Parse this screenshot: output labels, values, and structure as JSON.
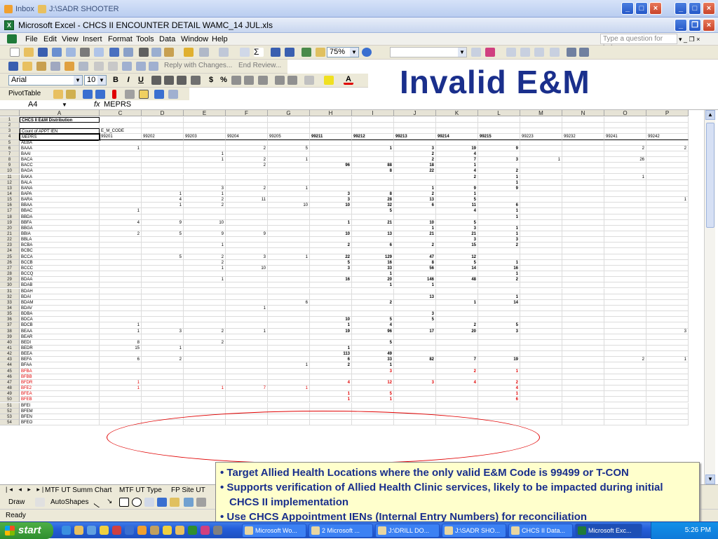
{
  "outer_window": {
    "tabs": [
      "Inbox",
      "J:\\SADR SHOOTER"
    ]
  },
  "excel": {
    "title": "Microsoft Excel - CHCS II ENCOUNTER DETAIL WAMC_14 JUL.xls",
    "menu": [
      "File",
      "Edit",
      "View",
      "Insert",
      "Format",
      "Tools",
      "Data",
      "Window",
      "Help"
    ],
    "ask_placeholder": "Type a question for help",
    "zoom": "75%",
    "font_name": "Arial",
    "font_size": "10",
    "reply_text": "Reply with Changes...",
    "end_review": "End Review...",
    "pivot_label": "PivotTable",
    "name_box": "A4",
    "fx": "fx",
    "formula_value": "MEPRS"
  },
  "slide": {
    "title": "Invalid E&M"
  },
  "grid": {
    "columns": [
      "A",
      "C",
      "D",
      "E",
      "F",
      "G",
      "H",
      "I",
      "J",
      "K",
      "L",
      "M",
      "N",
      "O",
      "P"
    ],
    "rows": [
      {
        "n": "1",
        "a": "CHCS II E&M Distribution",
        "v": [
          "",
          "",
          "",
          "",
          "",
          "",
          "",
          "",
          "",
          "",
          "",
          "",
          "",
          ""
        ]
      },
      {
        "n": "2",
        "a": "",
        "v": [
          "",
          "",
          "",
          "",
          "",
          "",
          "",
          "",
          "",
          "",
          "",
          "",
          "",
          ""
        ]
      },
      {
        "n": "3",
        "a": "Count of APPT IEN",
        "v": [
          "E_M_CODE",
          "",
          "",
          "",
          "",
          "",
          "",
          "",
          "",
          "",
          "",
          "",
          "",
          ""
        ]
      },
      {
        "n": "4",
        "a": "MEPRS",
        "v": [
          "99201",
          "99202",
          "99203",
          "99204",
          "99205",
          "99211",
          "99212",
          "99213",
          "99214",
          "99215",
          "99223",
          "99232",
          "99241",
          "99242"
        ]
      },
      {
        "n": "5",
        "a": "AEBA",
        "v": [
          "",
          "",
          "",
          "",
          "",
          "",
          "",
          "",
          "",
          "",
          "",
          "",
          "",
          ""
        ]
      },
      {
        "n": "6",
        "a": "BAAA",
        "v": [
          "1",
          "",
          "",
          "2",
          "5",
          "",
          "1",
          "3",
          "19",
          "9",
          "",
          "",
          "2",
          "2"
        ]
      },
      {
        "n": "7",
        "a": "BAAI",
        "v": [
          "",
          "",
          "1",
          "",
          "",
          "",
          "",
          "2",
          "4",
          "",
          "",
          "",
          "",
          ""
        ]
      },
      {
        "n": "8",
        "a": "BACA",
        "v": [
          "",
          "",
          "1",
          "2",
          "1",
          "",
          "",
          "2",
          "7",
          "3",
          "1",
          "",
          "26",
          ""
        ]
      },
      {
        "n": "9",
        "a": "BACC",
        "v": [
          "",
          "",
          "",
          "2",
          "",
          "96",
          "88",
          "18",
          "1",
          "",
          "",
          "",
          "",
          ""
        ]
      },
      {
        "n": "10",
        "a": "BAGA",
        "v": [
          "",
          "",
          "",
          "",
          "",
          "",
          "8",
          "22",
          "4",
          "2",
          "",
          "",
          "",
          ""
        ]
      },
      {
        "n": "11",
        "a": "BAKA",
        "v": [
          "",
          "",
          "",
          "",
          "",
          "",
          "",
          "",
          "2",
          "1",
          "",
          "",
          "1",
          ""
        ]
      },
      {
        "n": "12",
        "a": "BALA",
        "v": [
          "",
          "",
          "",
          "",
          "",
          "",
          "",
          "",
          "",
          "1",
          "",
          "",
          "",
          ""
        ]
      },
      {
        "n": "13",
        "a": "BANA",
        "v": [
          "",
          "",
          "3",
          "2",
          "1",
          "",
          "",
          "1",
          "9",
          "9",
          "",
          "",
          "",
          ""
        ]
      },
      {
        "n": "14",
        "a": "BAPA",
        "v": [
          "",
          "1",
          "1",
          "",
          "",
          "3",
          "8",
          "2",
          "1",
          "",
          "",
          "",
          "",
          ""
        ]
      },
      {
        "n": "15",
        "a": "BARA",
        "v": [
          "",
          "4",
          "2",
          "11",
          "",
          "3",
          "28",
          "13",
          "5",
          "",
          "",
          "",
          "",
          "1"
        ]
      },
      {
        "n": "16",
        "a": "BBAA",
        "v": [
          "",
          "1",
          "2",
          "",
          "10",
          "10",
          "32",
          "6",
          "11",
          "6",
          "",
          "",
          "",
          ""
        ]
      },
      {
        "n": "17",
        "a": "BBAC",
        "v": [
          "1",
          "",
          "",
          "",
          "",
          "",
          "5",
          "",
          "4",
          "1",
          "",
          "",
          "",
          ""
        ]
      },
      {
        "n": "18",
        "a": "BBDA",
        "v": [
          "",
          "",
          "",
          "",
          "",
          "",
          "",
          "",
          "",
          "1",
          "",
          "",
          "",
          ""
        ]
      },
      {
        "n": "19",
        "a": "BBFA",
        "v": [
          "4",
          "9",
          "10",
          "",
          "",
          "1",
          "21",
          "10",
          "5",
          "",
          "",
          "",
          "",
          ""
        ]
      },
      {
        "n": "20",
        "a": "BBGA",
        "v": [
          "",
          "",
          "",
          "",
          "",
          "",
          "",
          "1",
          "3",
          "1",
          "",
          "",
          "",
          ""
        ]
      },
      {
        "n": "21",
        "a": "BBIA",
        "v": [
          "2",
          "5",
          "9",
          "9",
          "",
          "10",
          "13",
          "21",
          "21",
          "1",
          "",
          "",
          "",
          ""
        ]
      },
      {
        "n": "22",
        "a": "BBLA",
        "v": [
          "",
          "",
          "",
          "",
          "",
          "",
          "",
          "",
          "3",
          "3",
          "",
          "",
          "",
          ""
        ]
      },
      {
        "n": "23",
        "a": "BCBA",
        "v": [
          "",
          "",
          "1",
          "",
          "",
          "2",
          "6",
          "2",
          "15",
          "2",
          "",
          "",
          "",
          ""
        ]
      },
      {
        "n": "24",
        "a": "BCBC",
        "v": [
          "",
          "",
          "",
          "",
          "",
          "",
          "",
          "",
          "",
          "",
          "",
          "",
          "",
          ""
        ]
      },
      {
        "n": "25",
        "a": "BCCA",
        "v": [
          "",
          "5",
          "2",
          "3",
          "1",
          "22",
          "129",
          "47",
          "12",
          "",
          "",
          "",
          "",
          ""
        ]
      },
      {
        "n": "26",
        "a": "BCCB",
        "v": [
          "",
          "",
          "2",
          "",
          "",
          "5",
          "16",
          "8",
          "5",
          "1",
          "",
          "",
          "",
          ""
        ]
      },
      {
        "n": "27",
        "a": "BCCC",
        "v": [
          "",
          "",
          "1",
          "10",
          "",
          "3",
          "33",
          "56",
          "14",
          "16",
          "",
          "",
          "",
          ""
        ]
      },
      {
        "n": "28",
        "a": "BCCQ",
        "v": [
          "",
          "",
          "",
          "",
          "",
          "",
          "1",
          "",
          "",
          "1",
          "",
          "",
          "",
          ""
        ]
      },
      {
        "n": "29",
        "a": "BDAA",
        "v": [
          "",
          "",
          "1",
          "",
          "",
          "16",
          "20",
          "146",
          "48",
          "2",
          "",
          "",
          "",
          ""
        ]
      },
      {
        "n": "30",
        "a": "BDAB",
        "v": [
          "",
          "",
          "",
          "",
          "",
          "",
          "1",
          "1",
          "",
          "",
          "",
          "",
          "",
          ""
        ]
      },
      {
        "n": "31",
        "a": "BDAH",
        "v": [
          "",
          "",
          "",
          "",
          "",
          "",
          "",
          "",
          "",
          "",
          "",
          "",
          "",
          ""
        ]
      },
      {
        "n": "32",
        "a": "BDAI",
        "v": [
          "",
          "",
          "",
          "",
          "",
          "",
          "",
          "13",
          "",
          "1",
          "",
          "",
          "",
          ""
        ]
      },
      {
        "n": "33",
        "a": "BDAM",
        "v": [
          "",
          "",
          "",
          "",
          "6",
          "",
          "2",
          "",
          "1",
          "14",
          "",
          "",
          "",
          ""
        ]
      },
      {
        "n": "34",
        "a": "BDAV",
        "v": [
          "",
          "",
          "",
          "1",
          "",
          "",
          "",
          "",
          "",
          "",
          "",
          "",
          "",
          ""
        ]
      },
      {
        "n": "35",
        "a": "BDBA",
        "v": [
          "",
          "",
          "",
          "",
          "",
          "",
          "",
          "3",
          "",
          "",
          "",
          "",
          "",
          ""
        ]
      },
      {
        "n": "36",
        "a": "BDCA",
        "v": [
          "",
          "",
          "",
          "",
          "",
          "10",
          "5",
          "5",
          "",
          "",
          "",
          "",
          "",
          ""
        ]
      },
      {
        "n": "37",
        "a": "BDCB",
        "v": [
          "1",
          "",
          "",
          "",
          "",
          "1",
          "4",
          "",
          "2",
          "5",
          "",
          "",
          "",
          ""
        ]
      },
      {
        "n": "38",
        "a": "BEAA",
        "v": [
          "1",
          "3",
          "2",
          "1",
          "",
          "19",
          "96",
          "17",
          "20",
          "3",
          "",
          "",
          "",
          "3"
        ]
      },
      {
        "n": "39",
        "a": "BEAR",
        "v": [
          "",
          "",
          "",
          "",
          "",
          "",
          "",
          "",
          "",
          "",
          "",
          "",
          "",
          ""
        ]
      },
      {
        "n": "40",
        "a": "BEDI",
        "v": [
          "8",
          "",
          "2",
          "",
          "",
          "",
          "5",
          "",
          "",
          "",
          "",
          "",
          "",
          ""
        ]
      },
      {
        "n": "41",
        "a": "BEDR",
        "v": [
          "15",
          "1",
          "",
          "",
          "",
          "1",
          "",
          "",
          "",
          "",
          "",
          "",
          "",
          ""
        ]
      },
      {
        "n": "42",
        "a": "BEEA",
        "v": [
          "",
          "",
          "",
          "",
          "",
          "113",
          "49",
          "",
          "",
          "",
          "",
          "",
          "",
          ""
        ]
      },
      {
        "n": "43",
        "a": "BEFA",
        "v": [
          "6",
          "2",
          "",
          "",
          "",
          "6",
          "33",
          "82",
          "7",
          "19",
          "",
          "",
          "2",
          "1"
        ]
      },
      {
        "n": "44",
        "a": "BFAA",
        "v": [
          "",
          "",
          "",
          "",
          "1",
          "2",
          "1",
          "",
          "",
          "",
          "",
          "",
          "",
          ""
        ]
      },
      {
        "n": "45",
        "a": "BFBA",
        "red": true,
        "v": [
          "",
          "",
          "",
          "",
          "",
          "",
          "3",
          "",
          "2",
          "1",
          "",
          "",
          "",
          ""
        ]
      },
      {
        "n": "46",
        "a": "BFBB",
        "red": true,
        "v": [
          "",
          "",
          "",
          "",
          "",
          "",
          "",
          "",
          "",
          "",
          "",
          "",
          "",
          ""
        ]
      },
      {
        "n": "47",
        "a": "BFDR",
        "red": true,
        "v": [
          "1",
          "",
          "",
          "",
          "",
          "4",
          "12",
          "3",
          "4",
          "2",
          "",
          "",
          "",
          ""
        ]
      },
      {
        "n": "48",
        "a": "BFE2",
        "red": true,
        "v": [
          "1",
          "",
          "1",
          "7",
          "1",
          "",
          "",
          "",
          "",
          "4",
          "",
          "",
          "",
          ""
        ]
      },
      {
        "n": "49",
        "a": "BFEA",
        "red": true,
        "v": [
          "",
          "",
          "",
          "",
          "",
          "1",
          "5",
          "",
          "",
          "1",
          "",
          "",
          "",
          ""
        ]
      },
      {
        "n": "50",
        "a": "BFEB",
        "red": true,
        "v": [
          "",
          "",
          "",
          "",
          "",
          "1",
          "1",
          "",
          "",
          "6",
          "",
          "",
          "",
          ""
        ]
      },
      {
        "n": "51",
        "a": "BFEI",
        "v": [
          "",
          "",
          "",
          "",
          "",
          "",
          "",
          "",
          "",
          "",
          "",
          "",
          "",
          ""
        ]
      },
      {
        "n": "52",
        "a": "BFEM",
        "v": [
          "",
          "",
          "",
          "",
          "",
          "",
          "",
          "",
          "",
          "",
          "",
          "",
          "",
          ""
        ]
      },
      {
        "n": "53",
        "a": "BFEN",
        "v": [
          "",
          "",
          "",
          "",
          "",
          "",
          "",
          "",
          "",
          "",
          "",
          "",
          "",
          ""
        ]
      },
      {
        "n": "54",
        "a": "BFEO",
        "v": [
          "",
          "",
          "",
          "",
          "",
          "",
          "",
          "",
          "",
          "",
          "",
          "",
          "",
          ""
        ]
      }
    ]
  },
  "sheet_tabs": [
    "MTF UT Summ Chart",
    "MTF UT Type",
    "FP Site UT"
  ],
  "drawbar": {
    "draw": "Draw",
    "autoshapes": "AutoShapes"
  },
  "status": "Ready",
  "callout": {
    "bullets": [
      "Target Allied Health Locations where the only valid E&M Code is 99499 or T-CON",
      "Supports verification of Allied Health Clinic services, likely to be impacted during initial CHCS II implementation",
      "Use CHCS Appointment IENs (Internal Entry Numbers) for reconciliation"
    ]
  },
  "taskbar": {
    "start": "start",
    "tasks": [
      "Microsoft Wo...",
      "2 Microsoft ...",
      "J:\\DRILL DO...",
      "J:\\SADR SHO...",
      "CHCS II Data...",
      "Microsoft Exc..."
    ],
    "clock": "5:26 PM"
  }
}
